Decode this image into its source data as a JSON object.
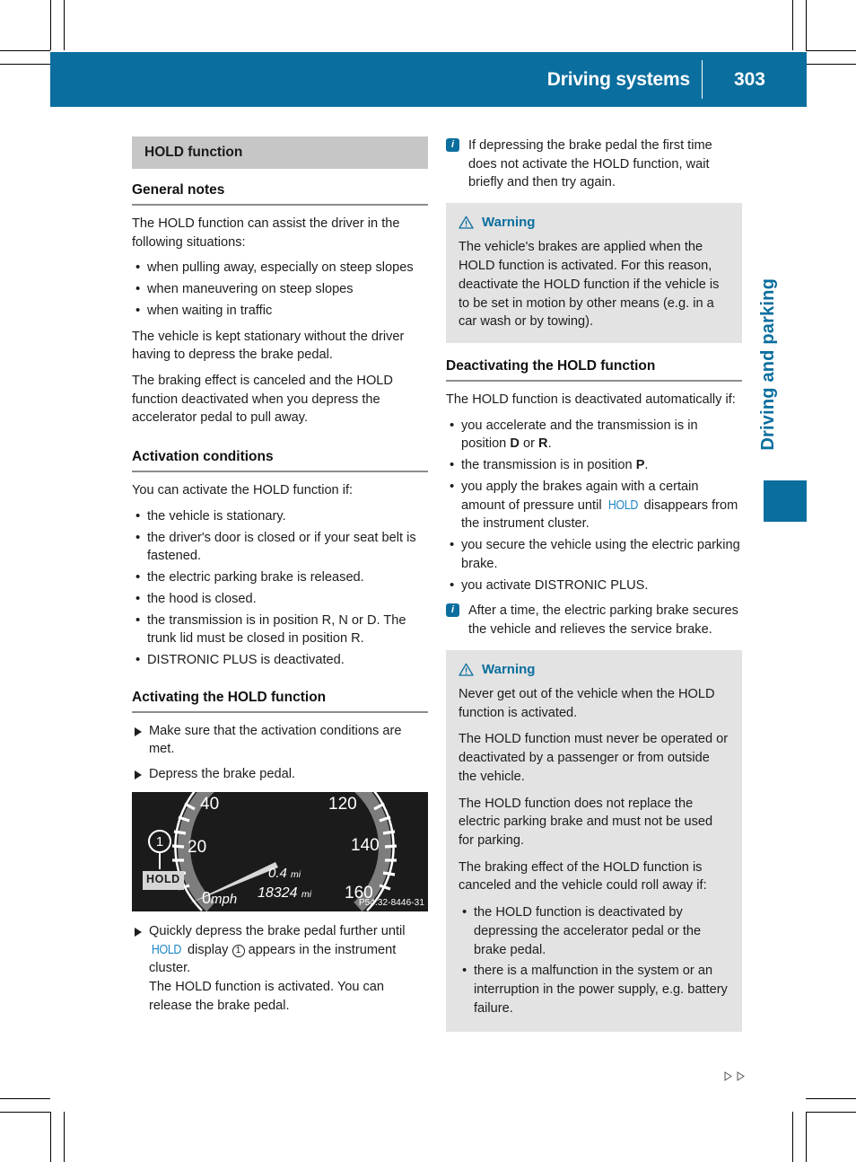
{
  "header": {
    "title": "Driving systems",
    "page_number": "303"
  },
  "side_tab": {
    "label": "Driving and parking"
  },
  "left_column": {
    "chip_title": "HOLD function",
    "general_notes": {
      "heading": "General notes",
      "intro": "The HOLD function can assist the driver in the following situations:",
      "bullets": [
        "when pulling away, especially on steep slopes",
        "when maneuvering on steep slopes",
        "when waiting in traffic"
      ],
      "para_1": "The vehicle is kept stationary without the driver having to depress the brake pedal.",
      "para_2": "The braking effect is canceled and the HOLD function deactivated when you depress the accelerator pedal to pull away."
    },
    "activation_conditions": {
      "heading": "Activation conditions",
      "intro": "You can activate the HOLD function if:",
      "bullets": [
        "the vehicle is stationary.",
        "the driver's door is closed or if your seat belt is fastened.",
        "the electric parking brake is released.",
        "the hood is closed.",
        "the transmission is in position R, N or D. The trunk lid must be closed in position R.",
        "DISTRONIC PLUS is deactivated."
      ]
    },
    "activating": {
      "heading": "Activating the HOLD function",
      "step_1": "Make sure that the activation conditions are met.",
      "step_2": "Depress the brake pedal.",
      "step_3_a": "Quickly depress the brake pedal further until",
      "step_3_hold": "HOLD",
      "step_3_b": "display",
      "step_3_callout": "1",
      "step_3_c": "appears in the instrument cluster.",
      "step_3_d": "The HOLD function is activated. You can release the brake pedal."
    },
    "figure": {
      "code": "P54.32-8446-31",
      "hold_badge": "HOLD",
      "callout": "1",
      "trip_value": "0.4",
      "trip_unit": "mi",
      "odometer_value": "18324",
      "odometer_unit": "mi",
      "speed_zero": "0",
      "speed_unit": "mph",
      "ticks": [
        "20",
        "40",
        "120",
        "140",
        "160"
      ]
    }
  },
  "right_column": {
    "note_1": "If depressing the brake pedal the first time does not activate the HOLD function, wait briefly and then try again.",
    "warning_1": {
      "title": "Warning",
      "body": "The vehicle's brakes are applied when the HOLD function is activated. For this reason, deactivate the HOLD function if the vehicle is to be set in motion by other means (e.g. in a car wash or by towing)."
    },
    "deactivating": {
      "heading": "Deactivating the HOLD function",
      "intro": "The HOLD function is deactivated automatically if:",
      "bullet_1_a": "you accelerate and the transmission is in position",
      "bullet_1_d": "D",
      "bullet_1_or": "or",
      "bullet_1_r": "R",
      "bullet_2_a": "the transmission is in position",
      "bullet_2_p": "P",
      "bullet_3_a": "you apply the brakes again with a certain amount of pressure until",
      "bullet_3_hold": "HOLD",
      "bullet_3_b": "disappears from the instrument cluster.",
      "bullet_4": "you secure the vehicle using the electric parking brake.",
      "bullet_5": "you activate DISTRONIC PLUS."
    },
    "note_2": "After a time, the electric parking brake secures the vehicle and relieves the service brake.",
    "warning_2": {
      "title": "Warning",
      "para_1": "Never get out of the vehicle when the HOLD function is activated.",
      "para_2": "The HOLD function must never be operated or deactivated by a passenger or from outside the vehicle.",
      "para_3": "The HOLD function does not replace the electric parking brake and must not be used for parking.",
      "para_4": "The braking effect of the HOLD function is canceled and the vehicle could roll away if:",
      "bullets": [
        "the HOLD function is deactivated by depressing the accelerator pedal or the brake pedal.",
        "there is a malfunction in the system or an interruption in the power supply, e.g. battery failure."
      ]
    }
  },
  "colors": {
    "brand_blue": "#0a6e9e",
    "hold_blue": "#1f86c5",
    "chip_gray": "#c6c6c6",
    "warn_gray": "#e3e3e3"
  }
}
